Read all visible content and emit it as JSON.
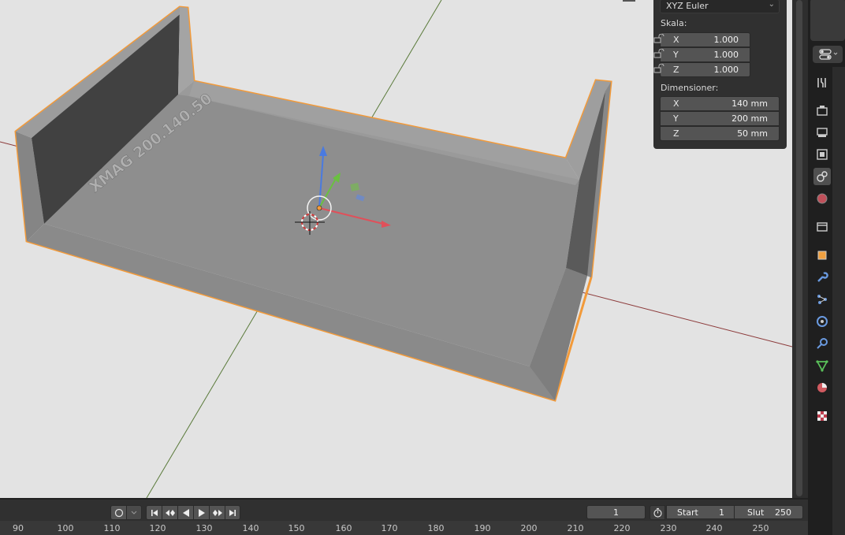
{
  "viewport": {
    "object_text": "XMAG 200.140.50",
    "colors": {
      "background": "#e3e3e3",
      "object": "#8c8c8c",
      "outline": "#f29a3a",
      "x_axis": "#8c3a3a",
      "y_axis": "#5a7a3a"
    }
  },
  "npanel": {
    "rotation_mode": "XYZ Euler",
    "scale_label": "Skala:",
    "scale": [
      {
        "axis": "X",
        "value": "1.000"
      },
      {
        "axis": "Y",
        "value": "1.000"
      },
      {
        "axis": "Z",
        "value": "1.000"
      }
    ],
    "dimensions_label": "Dimensioner:",
    "dimensions": [
      {
        "axis": "X",
        "value": "140 mm"
      },
      {
        "axis": "Y",
        "value": "200 mm"
      },
      {
        "axis": "Z",
        "value": "50 mm"
      }
    ]
  },
  "properties_tabs": [
    "tool-icon",
    "render-icon",
    "output-icon",
    "view-layer-icon",
    "scene-icon",
    "world-icon",
    "collection-icon",
    "object-icon",
    "modifier-icon",
    "particles-icon",
    "physics-icon",
    "constraints-icon",
    "data-icon",
    "material-icon",
    "texture-icon"
  ],
  "timeline": {
    "current_frame": "1",
    "start_label": "Start",
    "start_value": "1",
    "end_label": "Slut",
    "end_value": "250",
    "ruler": [
      "90",
      "100",
      "110",
      "120",
      "130",
      "140",
      "150",
      "160",
      "170",
      "180",
      "190",
      "200",
      "210",
      "220",
      "230",
      "240",
      "250"
    ]
  }
}
